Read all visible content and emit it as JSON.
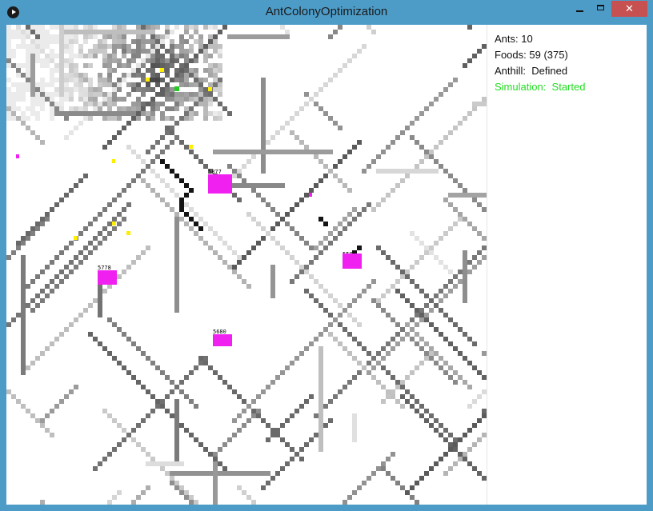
{
  "window": {
    "title": "AntColonyOptimization",
    "controls": {
      "minimize": "",
      "maximize": "",
      "close": "✕"
    }
  },
  "info": {
    "ants_label": "Ants:",
    "ants_value": "10",
    "foods_label": "Foods:",
    "foods_value": "59 (375)",
    "anthill_label": "Anthill:",
    "anthill_value": "Defined",
    "simulation_label": "Simulation:",
    "simulation_value": "Started"
  },
  "colors": {
    "food": "#f020f0",
    "ant": "#ffee00",
    "anthill": "#22cc22",
    "started": "#22dd22",
    "titlebar": "#4d9cc8",
    "close": "#c75050"
  },
  "food_sources": [
    {
      "label": "5877"
    },
    {
      "label": "5778"
    },
    {
      "label": "5586"
    },
    {
      "label": "5680"
    }
  ]
}
